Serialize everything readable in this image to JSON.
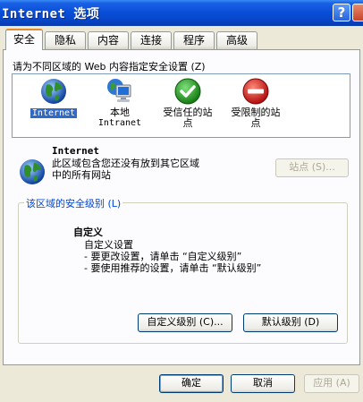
{
  "window": {
    "title": "Internet 选项"
  },
  "titlebar": {
    "help_label": "?"
  },
  "tabs": [
    {
      "label": "安全",
      "active": true
    },
    {
      "label": "隐私"
    },
    {
      "label": "内容"
    },
    {
      "label": "连接"
    },
    {
      "label": "程序"
    },
    {
      "label": "高级"
    }
  ],
  "security": {
    "prompt": "请为不同区域的 Web 内容指定安全设置 (Z)",
    "zones": [
      {
        "label": "Internet",
        "icon": "globe-icon",
        "selected": true
      },
      {
        "label_line1": "本地",
        "label_line2": "Intranet",
        "icon": "intranet-computer-icon"
      },
      {
        "label_line1": "受信任的站",
        "label_line2": "点",
        "icon": "trusted-checkmark-icon"
      },
      {
        "label_line1": "受限制的站",
        "label_line2": "点",
        "icon": "restricted-icon"
      }
    ],
    "selected_zone": {
      "name": "Internet",
      "description_line1": "此区域包含您还没有放到其它区域",
      "description_line2": "中的所有网站",
      "sites_button": "站点 (S)..."
    },
    "level_group": {
      "title": "该区域的安全级别 (L)",
      "level_name": "自定义",
      "lines": [
        "自定义设置",
        "- 要更改设置，请单击 “自定义级别”",
        "- 要使用推荐的设置，请单击 “默认级别”"
      ],
      "custom_button": "自定义级别 (C)...",
      "default_button": "默认级别 (D)"
    }
  },
  "footer": {
    "ok": "确定",
    "cancel": "取消",
    "apply": "应用 (A)"
  },
  "colors": {
    "title_blue": "#0a4fd8",
    "selection": "#316ac5",
    "group_title": "#0046d5",
    "active_tab_accent": "#e68b2c"
  }
}
